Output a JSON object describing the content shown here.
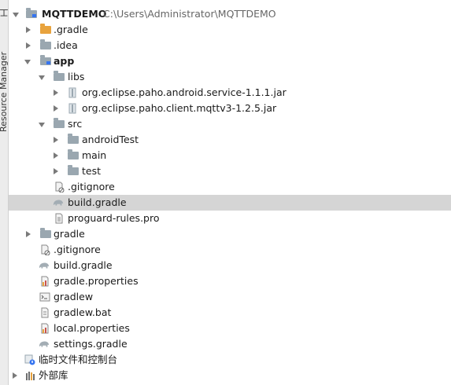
{
  "side_panel": {
    "tab_top": "工",
    "tab_resource": "Resource Manager"
  },
  "tree": {
    "root": {
      "name": "MQTTDEMO",
      "path": "C:\\Users\\Administrator\\MQTTDEMO"
    },
    "items": [
      {
        "label": ".gradle"
      },
      {
        "label": ".idea"
      },
      {
        "label": "app"
      },
      {
        "label": "libs"
      },
      {
        "label": "org.eclipse.paho.android.service-1.1.1.jar"
      },
      {
        "label": "org.eclipse.paho.client.mqttv3-1.2.5.jar"
      },
      {
        "label": "src"
      },
      {
        "label": "androidTest"
      },
      {
        "label": "main"
      },
      {
        "label": "test"
      },
      {
        "label": ".gitignore"
      },
      {
        "label": "build.gradle"
      },
      {
        "label": "proguard-rules.pro"
      },
      {
        "label": "gradle"
      },
      {
        "label": ".gitignore"
      },
      {
        "label": "build.gradle"
      },
      {
        "label": "gradle.properties"
      },
      {
        "label": "gradlew"
      },
      {
        "label": "gradlew.bat"
      },
      {
        "label": "local.properties"
      },
      {
        "label": "settings.gradle"
      },
      {
        "label": "临时文件和控制台"
      },
      {
        "label": "外部库"
      }
    ]
  },
  "colors": {
    "selection": "#d5d5d5",
    "folder": "#9aa7b0",
    "gradle_folder": "#e8a33d",
    "module_marker": "#3574f0"
  }
}
